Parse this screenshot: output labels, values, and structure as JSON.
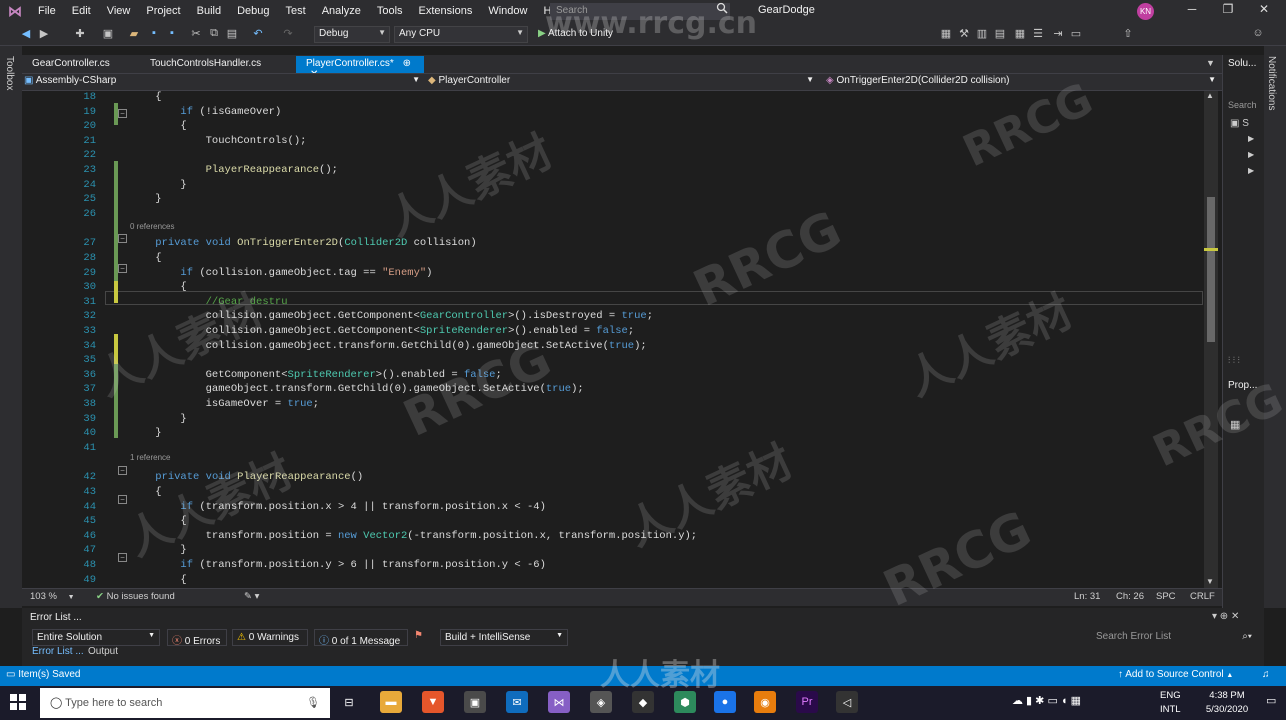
{
  "menubar": {
    "items": [
      "File",
      "Edit",
      "View",
      "Project",
      "Build",
      "Debug",
      "Test",
      "Analyze",
      "Tools",
      "Extensions",
      "Window",
      "Help"
    ],
    "search_placeholder": "Search",
    "solution_title": "GearDodge",
    "user_initials": "KN"
  },
  "toolbar": {
    "config": "Debug",
    "platform": "Any CPU",
    "attach": "Attach to Unity"
  },
  "toolbox_label": "Toolbox",
  "notifications_label": "Notifications",
  "tabs": [
    {
      "label": "GearController.cs"
    },
    {
      "label": "TouchControlsHandler.cs"
    },
    {
      "label": "PlayerController.cs*"
    }
  ],
  "navbar": {
    "project": "Assembly-CSharp",
    "class": "PlayerController",
    "member": "OnTriggerEnter2D(Collider2D collision)"
  },
  "code_lines": [
    {
      "n": "18",
      "t": "    {"
    },
    {
      "n": "19",
      "t": "        if (!isGameOver)"
    },
    {
      "n": "20",
      "t": "        {"
    },
    {
      "n": "21",
      "t": "            TouchControls();"
    },
    {
      "n": "22",
      "t": ""
    },
    {
      "n": "23",
      "t": "            PlayerReappearance();"
    },
    {
      "n": "24",
      "t": "        }"
    },
    {
      "n": "25",
      "t": "    }"
    },
    {
      "n": "26",
      "t": ""
    },
    {
      "n": "27",
      "t": "    private void OnTriggerEnter2D(Collider2D collision)"
    },
    {
      "n": "28",
      "t": "    {"
    },
    {
      "n": "29",
      "t": "        if (collision.gameObject.tag == \"Enemy\")"
    },
    {
      "n": "30",
      "t": "        {"
    },
    {
      "n": "31",
      "t": "            //Gear destru"
    },
    {
      "n": "32",
      "t": "            collision.gameObject.GetComponent<GearController>().isDestroyed = true;"
    },
    {
      "n": "33",
      "t": "            collision.gameObject.GetComponent<SpriteRenderer>().enabled = false;"
    },
    {
      "n": "34",
      "t": "            collision.gameObject.transform.GetChild(0).gameObject.SetActive(true);"
    },
    {
      "n": "35",
      "t": ""
    },
    {
      "n": "36",
      "t": "            GetComponent<SpriteRenderer>().enabled = false;"
    },
    {
      "n": "37",
      "t": "            gameObject.transform.GetChild(0).gameObject.SetActive(true);"
    },
    {
      "n": "38",
      "t": "            isGameOver = true;"
    },
    {
      "n": "39",
      "t": "        }"
    },
    {
      "n": "40",
      "t": "    }"
    },
    {
      "n": "41",
      "t": ""
    },
    {
      "n": "42",
      "t": "    private void PlayerReappearance()"
    },
    {
      "n": "43",
      "t": "    {"
    },
    {
      "n": "44",
      "t": "        if (transform.position.x > 4 || transform.position.x < -4)"
    },
    {
      "n": "45",
      "t": "        {"
    },
    {
      "n": "46",
      "t": "            transform.position = new Vector2(-transform.position.x, transform.position.y);"
    },
    {
      "n": "47",
      "t": "        }"
    },
    {
      "n": "48",
      "t": "        if (transform.position.y > 6 || transform.position.y < -6)"
    },
    {
      "n": "49",
      "t": "        {"
    }
  ],
  "references": {
    "ontrigger": "0 references",
    "reappearance": "1 reference"
  },
  "editor_status": {
    "zoom": "103 %",
    "issues": "No issues found",
    "line": "Ln: 31",
    "col": "Ch: 26",
    "spc": "SPC",
    "crlf": "CRLF"
  },
  "right_panel": {
    "solution": "Solu...",
    "search": "Search",
    "properties": "Prop..."
  },
  "errorlist": {
    "title": "Error List ...",
    "scope": "Entire Solution",
    "errors": "0 Errors",
    "warnings": "0 Warnings",
    "messages": "0 of 1 Message",
    "build": "Build + IntelliSense",
    "search_placeholder": "Search Error List",
    "tab_errorlist": "Error List ...",
    "tab_output": "Output"
  },
  "statusbar": {
    "saved": "Item(s) Saved",
    "source_control": "Add to Source Control"
  },
  "taskbar": {
    "search_placeholder": "Type here to search",
    "lang": "ENG",
    "region": "INTL",
    "time": "4:38 PM",
    "date": "5/30/2020"
  },
  "watermark": {
    "rrcg": "www.rrcg.cn",
    "brand": "RRCG",
    "cn": "人人素材"
  }
}
